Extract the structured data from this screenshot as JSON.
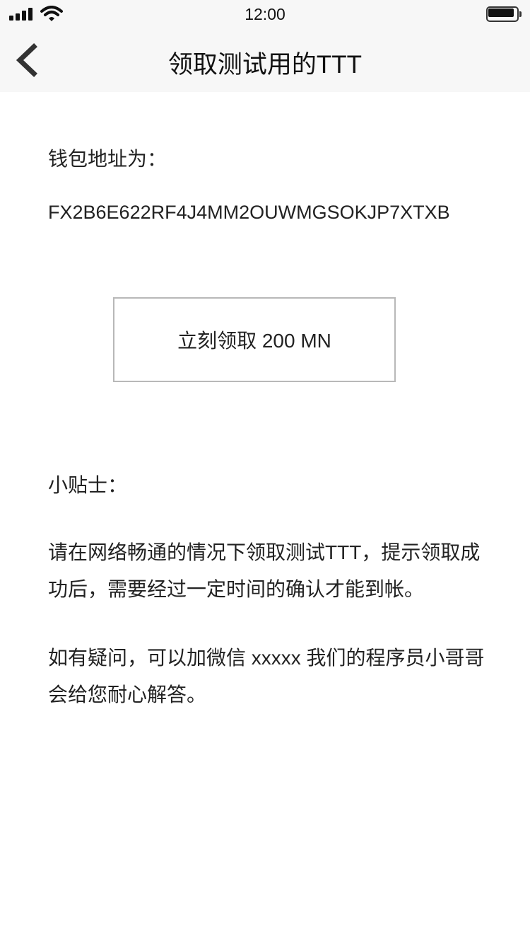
{
  "status_bar": {
    "time": "12:00",
    "icons": [
      "signal-icon",
      "wifi-icon",
      "battery-icon"
    ]
  },
  "nav": {
    "back_icon": "chevron-left-icon",
    "title": "领取测试用的TTT"
  },
  "wallet": {
    "label": "钱包地址为：",
    "address": "FX2B6E622RF4J4MM2OUWMGSOKJP7XTXB"
  },
  "claim_button": {
    "label": "立刻领取 200 MN"
  },
  "tips": {
    "title": "小贴士：",
    "paragraphs": [
      "请在网络畅通的情况下领取测试TTT，提示领取成功后，需要经过一定时间的确认才能到帐。",
      "如有疑问，可以加微信 xxxxx 我们的程序员小哥哥会给您耐心解答。"
    ]
  },
  "colors": {
    "bar_background": "#f7f7f7",
    "text": "#222222",
    "button_border": "#b8b8b8"
  }
}
